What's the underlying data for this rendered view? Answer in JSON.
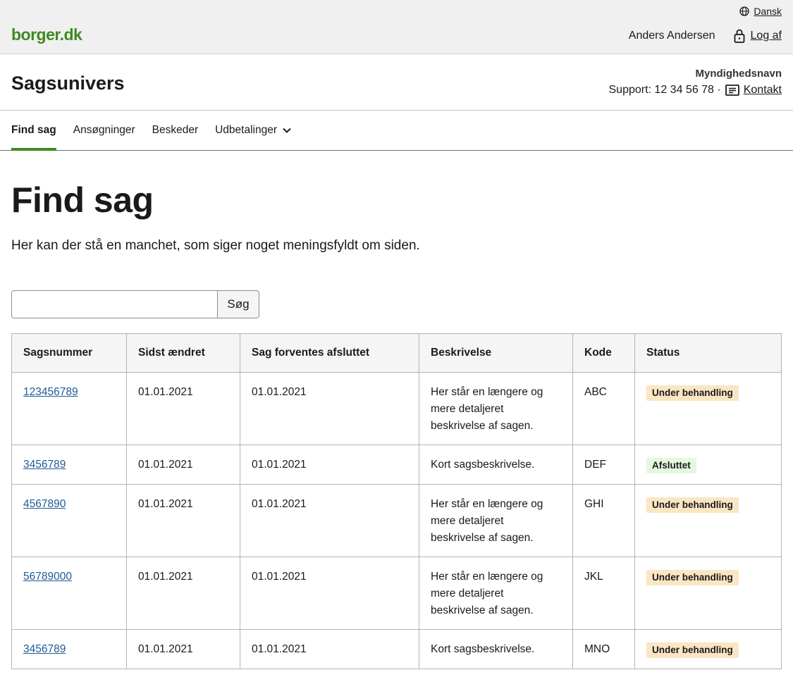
{
  "portal": {
    "language": "Dansk",
    "logo": "borger.dk",
    "user": "Anders Andersen",
    "logout": "Log af"
  },
  "solution": {
    "title": "Sagsunivers",
    "authority": "Myndighedsnavn",
    "support": "Support: 12 34 56 78 ·",
    "contact": "Kontakt"
  },
  "nav": {
    "items": [
      {
        "label": "Find sag"
      },
      {
        "label": "Ansøgninger"
      },
      {
        "label": "Beskeder"
      },
      {
        "label": "Udbetalinger"
      }
    ]
  },
  "page": {
    "title": "Find sag",
    "lead": "Her kan der stå en manchet, som siger noget meningsfyldt om siden."
  },
  "search": {
    "value": "",
    "button": "Søg"
  },
  "table": {
    "headers": [
      "Sagsnummer",
      "Sidst ændret",
      "Sag forventes afsluttet",
      "Beskrivelse",
      "Kode",
      "Status"
    ],
    "rows": [
      {
        "id": "123456789",
        "changed": "01.01.2021",
        "expected": "01.01.2021",
        "desc": "Her står en længere og mere detaljeret beskrivelse af sagen.",
        "code": "ABC",
        "status": "Under behandling",
        "status_type": "warn"
      },
      {
        "id": "3456789",
        "changed": "01.01.2021",
        "expected": "01.01.2021",
        "desc": "Kort sagsbeskrivelse.",
        "code": "DEF",
        "status": "Afsluttet",
        "status_type": "done"
      },
      {
        "id": "4567890",
        "changed": "01.01.2021",
        "expected": "01.01.2021",
        "desc": "Her står en længere og mere detaljeret beskrivelse af sagen.",
        "code": "GHI",
        "status": "Under behandling",
        "status_type": "warn"
      },
      {
        "id": "56789000",
        "changed": "01.01.2021",
        "expected": "01.01.2021",
        "desc": "Her står en længere og mere detaljeret beskrivelse af sagen.",
        "code": "JKL",
        "status": "Under behandling",
        "status_type": "warn"
      },
      {
        "id": "3456789",
        "changed": "01.01.2021",
        "expected": "01.01.2021",
        "desc": "Kort sagsbeskrivelse.",
        "code": "MNO",
        "status": "Under behandling",
        "status_type": "warn"
      }
    ]
  },
  "colors": {
    "brand": "#3d8a23",
    "link": "#1f5a96",
    "badge_warn": "#fbe6c4",
    "badge_done": "#e4f7df"
  }
}
